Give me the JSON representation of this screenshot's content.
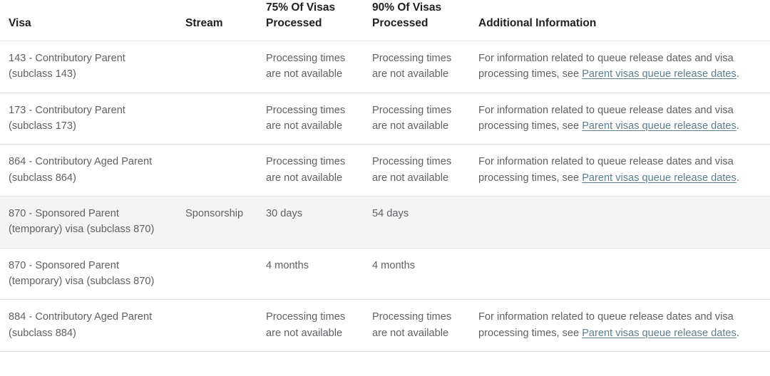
{
  "table": {
    "columns": [
      {
        "key": "visa",
        "label": "Visa"
      },
      {
        "key": "stream",
        "label": "Stream"
      },
      {
        "key": "p75",
        "label": "75% Of Visas Processed"
      },
      {
        "key": "p90",
        "label": "90% Of Visas Processed"
      },
      {
        "key": "info",
        "label": "Additional Information"
      }
    ],
    "header_lines": {
      "visa": [
        "Visa"
      ],
      "stream": [
        "Stream"
      ],
      "p75": [
        "75% Of Visas",
        "Processed"
      ],
      "p90": [
        "90% Of Visas",
        "Processed"
      ],
      "info": [
        "Additional Information"
      ]
    },
    "unavailable_text": "Processing times are not available",
    "info_prefix": "For information related to queue release dates and visa processing times, see ",
    "info_link_text": "Parent visas queue release dates",
    "info_suffix": ".",
    "rows": [
      {
        "visa": "143 - Contributory Parent (subclass 143)",
        "stream": "",
        "p75": "Processing times are not available",
        "p90": "Processing times are not available",
        "has_info": true,
        "shaded": false
      },
      {
        "visa": "173 - Contributory Parent (subclass 173)",
        "stream": "",
        "p75": "Processing times are not available",
        "p90": "Processing times are not available",
        "has_info": true,
        "shaded": false
      },
      {
        "visa": "864 - Contributory Aged Parent (subclass 864)",
        "stream": "",
        "p75": "Processing times are not available",
        "p90": "Processing times are not available",
        "has_info": true,
        "shaded": false
      },
      {
        "visa": "870 - Sponsored Parent (temporary) visa (subclass 870)",
        "stream": "Sponsorship",
        "p75": "30 days",
        "p90": "54 days",
        "has_info": false,
        "shaded": true
      },
      {
        "visa": "870 - Sponsored Parent (temporary) visa (subclass 870)",
        "stream": "",
        "p75": "4 months",
        "p90": "4 months",
        "has_info": false,
        "shaded": false
      },
      {
        "visa": "884 - Contributory Aged Parent (subclass 884)",
        "stream": "",
        "p75": "Processing times are not available",
        "p90": "Processing times are not available",
        "has_info": true,
        "shaded": false
      }
    ]
  },
  "colors": {
    "header_text": "#1f1f22",
    "body_text": "#5e6164",
    "link": "#5d7d8c",
    "row_shaded_bg": "#f4f4f4",
    "divider": "#e2e2e2",
    "page_bg": "#ffffff"
  }
}
